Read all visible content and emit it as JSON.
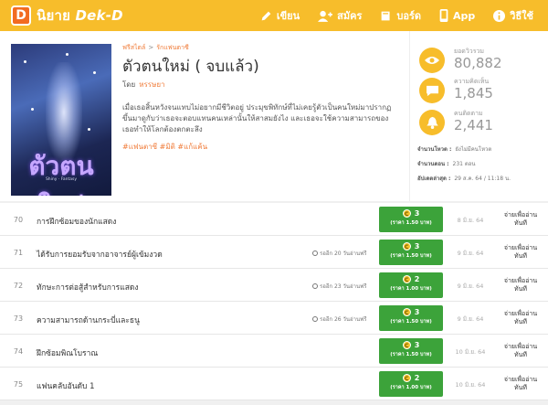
{
  "brand": {
    "logo_letter": "D",
    "name": "นิยาย",
    "name_latin": "Dek-D"
  },
  "nav": [
    {
      "label": "เขียน",
      "icon": "pencil-icon"
    },
    {
      "label": "สมัคร",
      "icon": "add-user-icon"
    },
    {
      "label": "บอร์ด",
      "icon": "book-icon"
    },
    {
      "label": "App",
      "icon": "phone-icon"
    },
    {
      "label": "วิธีใช้",
      "icon": "info-icon"
    }
  ],
  "breadcrumb": {
    "category": "ฟรีสไตล์",
    "subcategory": "รักแฟนตาซี"
  },
  "novel": {
    "title": "ตัวตนใหม่ ( จบแล้ว)",
    "author_prefix": "โดย",
    "author": "หรรษยา",
    "synopsis": "เมื่อเธอสิ้นหวังจนแทบไม่อยากมีชีวิตอยู่ ประมุขพิทักษ์ที่ไม่เคยรู้ตัวเป็นคนใหม่มาปรากฏขึ้นมาดูกับว่าเธอจะตอบแทนคนเหล่านั้นให้สาสมยังไง และเธอจะใช้ความสามารถของเธอทำให้โลกต้องตกตะลึง",
    "tags": "#แฟนตาซี #มิติ #แก้แค้น",
    "cover_title": "ตัวตน ใหม่",
    "cover_sub": "Shiny · Fantasy"
  },
  "stats": [
    {
      "label": "ยอดวิวรวม",
      "value": "80,882",
      "icon": "eye-icon"
    },
    {
      "label": "ความคิดเห็น",
      "value": "1,845",
      "icon": "comment-icon"
    },
    {
      "label": "คนติดตาม",
      "value": "2,441",
      "icon": "bell-icon"
    }
  ],
  "meta": [
    {
      "label": "จำนวนโหวต :",
      "value": "ยังไม่มีคนโหวต"
    },
    {
      "label": "จำนวนตอน :",
      "value": "231 ตอน"
    },
    {
      "label": "อัปเดตล่าสุด :",
      "value": "29 ส.ค. 64 / 11:18 น."
    }
  ],
  "chapters": [
    {
      "num": "70",
      "name": "การฝึกซ้อมของนักแสดง",
      "free": "",
      "coins": "3",
      "price": "(ราคา 1.50 บาท)",
      "date": "8 มิ.ย. 64",
      "buy": "จ่ายเพื่ออ่านทันที"
    },
    {
      "num": "71",
      "name": "ได้รับการยอมรับจากอาจารย์ผู้เข้มงวด",
      "free": "รออีก 20 วันอ่านฟรี",
      "coins": "3",
      "price": "(ราคา 1.50 บาท)",
      "date": "9 มิ.ย. 64",
      "buy": "จ่ายเพื่ออ่านทันที"
    },
    {
      "num": "72",
      "name": "ทักษะการต่อสู้สำหรับการแสดง",
      "free": "รออีก 23 วันอ่านฟรี",
      "coins": "2",
      "price": "(ราคา 1.00 บาท)",
      "date": "9 มิ.ย. 64",
      "buy": "จ่ายเพื่ออ่านทันที"
    },
    {
      "num": "73",
      "name": "ความสามารถด้านกระบี่และธนู",
      "free": "รออีก 26 วันอ่านฟรี",
      "coins": "3",
      "price": "(ราคา 1.50 บาท)",
      "date": "9 มิ.ย. 64",
      "buy": "จ่ายเพื่ออ่านทันที"
    },
    {
      "num": "74",
      "name": "ฝึกซ้อมพิณโบราณ",
      "free": "",
      "coins": "3",
      "price": "(ราคา 1.50 บาท)",
      "date": "10 มิ.ย. 64",
      "buy": "จ่ายเพื่ออ่านทันที"
    },
    {
      "num": "75",
      "name": "แฟนคลับอันดับ 1",
      "free": "",
      "coins": "2",
      "price": "(ราคา 1.00 บาท)",
      "date": "10 มิ.ย. 64",
      "buy": "จ่ายเพื่ออ่านทันที"
    }
  ],
  "colors": {
    "brand": "#f7bd2b",
    "accent": "#f07c3a",
    "price": "#3ca33a"
  }
}
